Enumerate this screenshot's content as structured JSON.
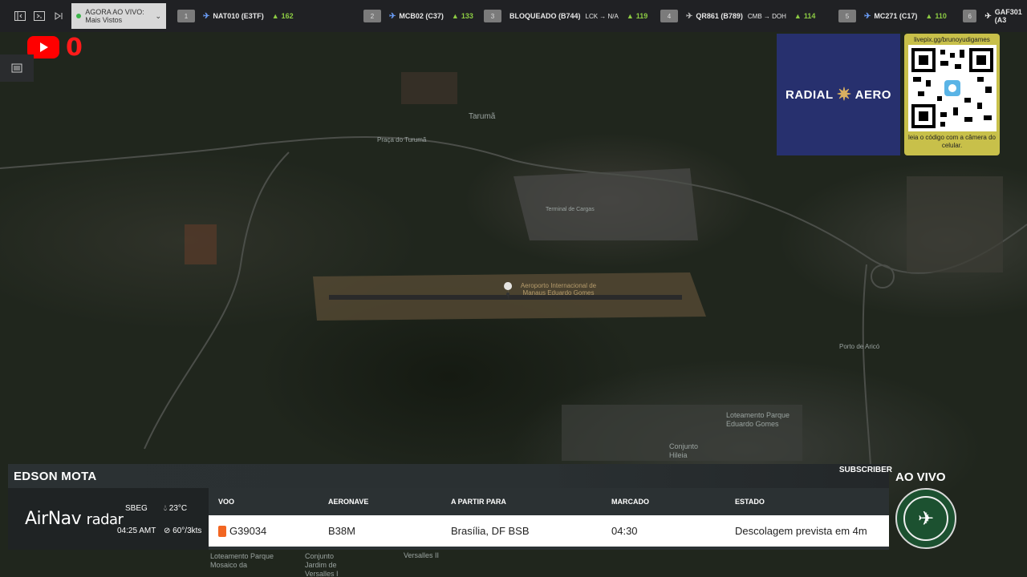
{
  "toolbar": {
    "select_value": "AGORA AO VIVO: Mais Vistos",
    "flights": [
      {
        "rank": "1",
        "callsign": "NAT010 (E3TF)",
        "route": "",
        "count": "162"
      },
      {
        "rank": "2",
        "callsign": "MCB02 (C37)",
        "route": "",
        "count": "133"
      },
      {
        "rank": "3",
        "callsign": "BLOQUEADO (B744)",
        "route": "LCK → N/A",
        "count": "119"
      },
      {
        "rank": "4",
        "callsign": "QR861 (B789)",
        "route": "CMB → DOH",
        "count": "114"
      },
      {
        "rank": "5",
        "callsign": "MC271 (C17)",
        "route": "",
        "count": "110"
      },
      {
        "rank": "6",
        "callsign": "GAF301 (A3",
        "route": "",
        "count": ""
      }
    ]
  },
  "youtube": {
    "count": "0"
  },
  "map": {
    "labels": [
      "Tarumã",
      "Praça do Turumã",
      "Terminal de Cargas",
      "Aeroporto Internacional de Manaus Eduardo Gomes",
      "Porto de Aricó",
      "Loteamento Parque Eduardo Gomes",
      "Conjunto Hileia",
      "Loteamento Parque Mosaico da",
      "Conjunto Jardim de Versalles I",
      "Versalles II"
    ]
  },
  "ads": {
    "radial_left": "RADIAL",
    "radial_right": "AERO",
    "qr_url": "livepix.gg/brunoyudigames",
    "qr_caption": "leia o código com a câmera do celular."
  },
  "news": {
    "anchor": "EDSON MOTA",
    "subscriber": "SUBSCRIBER",
    "brand": "AirNav",
    "brand_suffix": "radar",
    "airport": "SBEG",
    "time": "04:25 AMT",
    "temp": "23°C",
    "wind": "60°/3kts",
    "headers": [
      "VOO",
      "AERONAVE",
      "A PARTIR PARA",
      "MARCADO",
      "ESTADO"
    ],
    "row": [
      "G39034",
      "B38M",
      "Brasília, DF BSB",
      "04:30",
      "Descolagem prevista em 4m"
    ]
  },
  "live_label": "AO VIVO",
  "colors": {
    "accent_red": "#ff0000",
    "panel_dark": "#2b3133",
    "radial_blue": "#27306e",
    "qr_gold": "#c8c04a",
    "orange_badge": "#f26622"
  }
}
